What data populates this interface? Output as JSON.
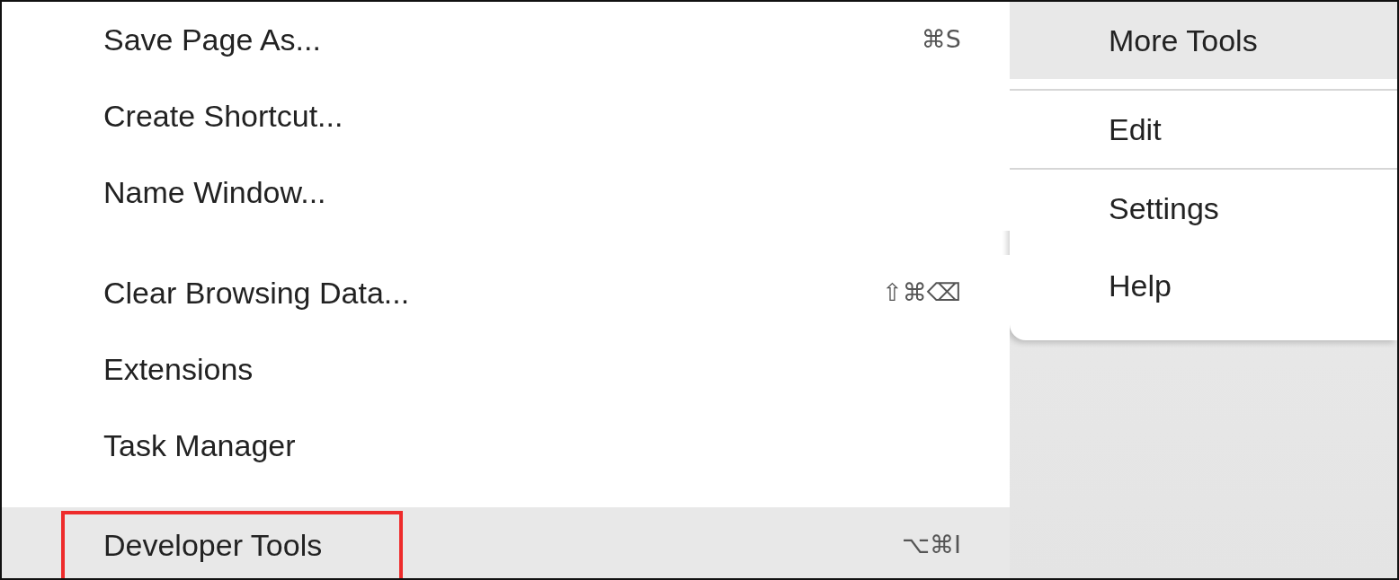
{
  "main_menu": {
    "sections": [
      [
        {
          "label": "Save Page As...",
          "shortcut": "⌘S",
          "selected": false,
          "annotated": false
        },
        {
          "label": "Create Shortcut...",
          "selected": false,
          "annotated": false
        },
        {
          "label": "Name Window...",
          "selected": false,
          "annotated": false
        }
      ],
      [
        {
          "label": "Clear Browsing Data...",
          "shortcut": "⇧⌘⌫",
          "selected": false,
          "annotated": false
        },
        {
          "label": "Extensions",
          "selected": false,
          "annotated": false
        },
        {
          "label": "Task Manager",
          "selected": false,
          "annotated": false
        }
      ],
      [
        {
          "label": "Developer Tools",
          "shortcut": "⌥⌘I",
          "selected": true,
          "annotated": true
        }
      ]
    ]
  },
  "side_menu": {
    "sections": [
      [
        {
          "label": "More Tools",
          "selected": true
        }
      ],
      [
        {
          "label": "Edit",
          "selected": false
        }
      ],
      [
        {
          "label": "Settings",
          "selected": false
        },
        {
          "label": "Help",
          "selected": false
        }
      ]
    ]
  }
}
